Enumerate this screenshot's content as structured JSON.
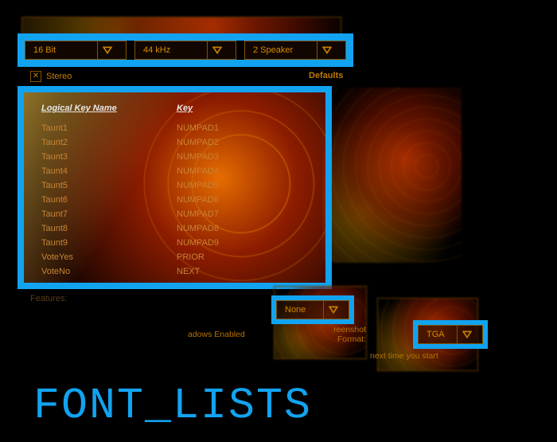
{
  "top_dropdowns": {
    "bit_depth": {
      "value": "16 Bit"
    },
    "sample_rate": {
      "value": "44 kHz"
    },
    "speakers": {
      "value": "2 Speaker"
    }
  },
  "stereo_checkbox": {
    "label": "Stereo",
    "checked": true
  },
  "defaults_label": "Defaults",
  "key_panel": {
    "header_logical": "Logical Key Name",
    "header_key": "Key",
    "rows": [
      {
        "name": "Taunt1",
        "key": "NUMPAD1"
      },
      {
        "name": "Taunt2",
        "key": "NUMPAD2"
      },
      {
        "name": "Taunt3",
        "key": "NUMPAD3"
      },
      {
        "name": "Taunt4",
        "key": "NUMPAD4"
      },
      {
        "name": "Taunt5",
        "key": "NUMPAD5"
      },
      {
        "name": "Taunt6",
        "key": "NUMPAD6"
      },
      {
        "name": "Taunt7",
        "key": "NUMPAD7"
      },
      {
        "name": "Taunt8",
        "key": "NUMPAD8"
      },
      {
        "name": "Taunt9",
        "key": "NUMPAD9"
      },
      {
        "name": "VoteYes",
        "key": "PRIOR"
      },
      {
        "name": "VoteNo",
        "key": "NEXT"
      }
    ]
  },
  "features_cutoff": "Features:",
  "lower": {
    "shadows_label": "adows Enabled",
    "shadows_dropdown": {
      "value": "None"
    },
    "screenshot_label": "reenshot Format:",
    "screenshot_dropdown": {
      "value": "TGA"
    },
    "restart_hint": "next time you start"
  },
  "big_title": "FONT_LISTS",
  "colors": {
    "accent": "#12a3f0",
    "ui_orange": "#c47f00"
  }
}
